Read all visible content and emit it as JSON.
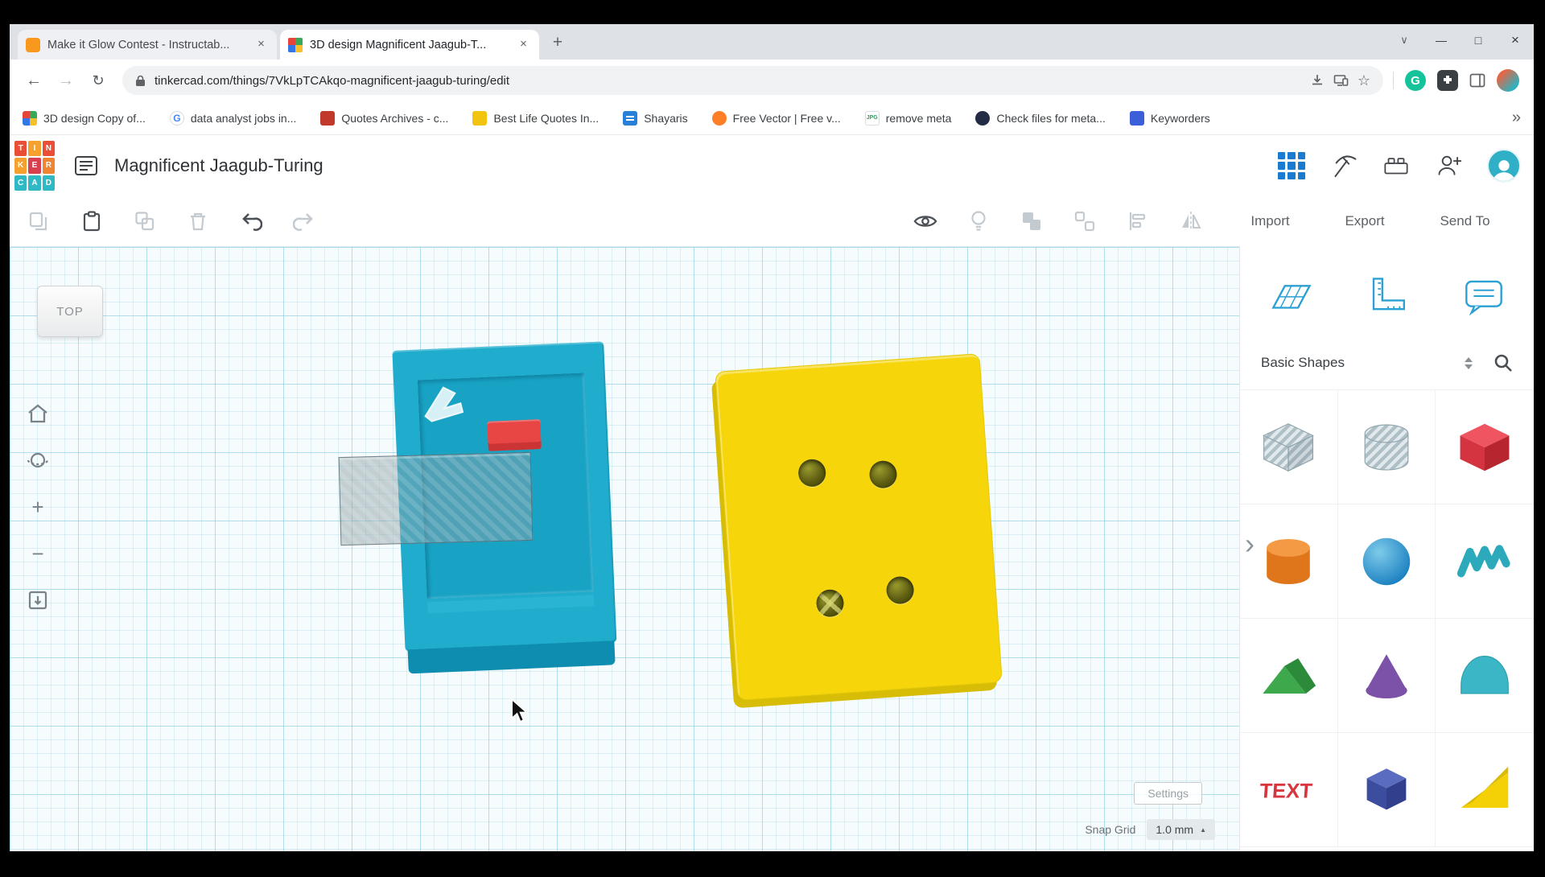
{
  "browser": {
    "tabs": [
      {
        "title": "Make it Glow Contest - Instructab..."
      },
      {
        "title": "3D design Magnificent Jaagub-T..."
      }
    ],
    "url": "tinkercad.com/things/7VkLpTCAkqo-magnificent-jaagub-turing/edit",
    "bookmarks": [
      "3D design Copy of...",
      "data analyst jobs in...",
      "Quotes Archives - c...",
      "Best Life Quotes In...",
      "Shayaris",
      "Free Vector | Free v...",
      "remove meta",
      "Check files for meta...",
      "Keyworders"
    ],
    "glyphs": {
      "grammarly": "G",
      "google": "G",
      "jpg": "JPG"
    }
  },
  "app": {
    "title": "Magnificent Jaagub-Turing",
    "logo_letters": "TINKERCAD",
    "actions": {
      "import": "Import",
      "export": "Export",
      "send_to": "Send To"
    },
    "viewport": {
      "viewcube": "TOP",
      "settings": "Settings",
      "snap_grid_label": "Snap Grid",
      "snap_grid_value": "1.0 mm"
    },
    "sidebar": {
      "category": "Basic Shapes",
      "text_glyph": "TEXT"
    }
  },
  "colors": {
    "accent_blue": "#1b7bd0",
    "object_teal": "#20accd",
    "object_yellow": "#f6d50b",
    "object_red": "#e84545",
    "grid_line": "#cfe8ee"
  }
}
